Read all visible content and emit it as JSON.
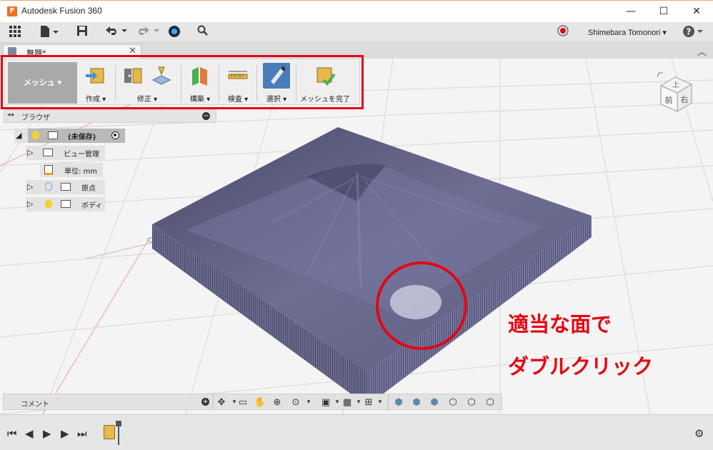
{
  "window": {
    "title": "Autodesk Fusion 360",
    "minimize": "—",
    "maximize": "☐",
    "close": "✕"
  },
  "qat": {
    "user": "Shimebara Tomonori ▾",
    "help": "?"
  },
  "tab": {
    "title": "無題*"
  },
  "ribbon": {
    "workspace": "メッシュ ▾",
    "tools": [
      {
        "label": "作成 ▾"
      },
      {
        "label": "修正 ▾"
      },
      {
        "label": "構築 ▾"
      },
      {
        "label": "検査 ▾"
      },
      {
        "label": "選択 ▾"
      },
      {
        "label": "メッシュを完了"
      }
    ]
  },
  "browser": {
    "title": "ブラウザ",
    "root": "(未保存)",
    "items": [
      {
        "label": "ビュー管理"
      },
      {
        "label": "単位: mm"
      },
      {
        "label": "原点"
      },
      {
        "label": "ボディ"
      }
    ]
  },
  "viewcube": {
    "top": "上",
    "front": "前",
    "right": "右"
  },
  "annotation": {
    "line1": "適当な面で",
    "line2": "ダブルクリック",
    "color": "#e30613"
  },
  "bottom": {
    "comment": "コメント"
  },
  "colors": {
    "mesh": "#5a5a7c",
    "highlight": "#e30613"
  }
}
